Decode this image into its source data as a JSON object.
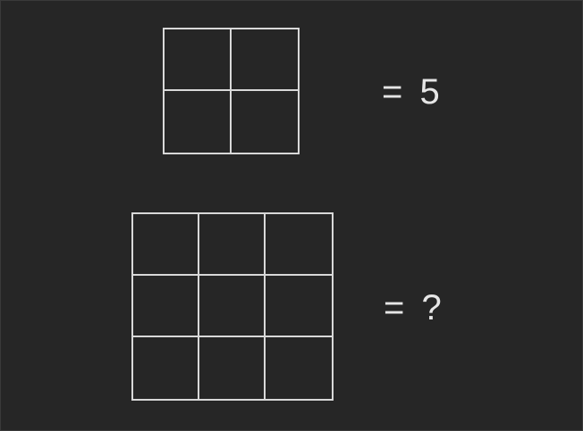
{
  "puzzle": {
    "rows": [
      {
        "grid": {
          "rows": 2,
          "cols": 2
        },
        "label": "= 5"
      },
      {
        "grid": {
          "rows": 3,
          "cols": 3
        },
        "label": "= ?"
      }
    ]
  },
  "colors": {
    "background": "#262626",
    "line": "#d8d8d8",
    "text": "#e6e6e6"
  }
}
